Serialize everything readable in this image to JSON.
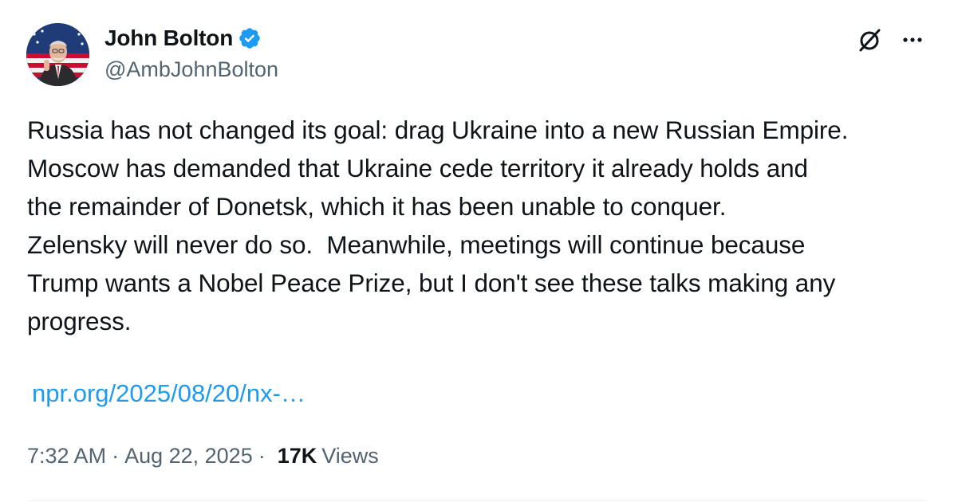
{
  "author": {
    "display_name": "John Bolton",
    "handle": "@AmbJohnBolton",
    "verified": true,
    "verified_color": "#1d9bf0"
  },
  "tweet": {
    "text": "Russia has not changed its goal: drag Ukraine into a new Russian Empire.\nMoscow has demanded that Ukraine cede territory it already holds and\nthe remainder of Donetsk, which it has been unable to conquer.\nZelensky will never do so.  Meanwhile, meetings will continue because\nTrump wants a Nobel Peace Prize, but I don't see these talks making any\nprogress.",
    "link_text": "npr.org/2025/08/20/nx-…",
    "link_color": "#1d9bf0"
  },
  "meta": {
    "time": "7:32 AM",
    "separator": "·",
    "date": "Aug 22, 2025",
    "views_count": "17K",
    "views_label": "Views"
  },
  "icons": {
    "avatar": "avatar-photo",
    "verified": "verified-badge-icon",
    "grok": "grok-icon",
    "more": "more-options-icon"
  }
}
